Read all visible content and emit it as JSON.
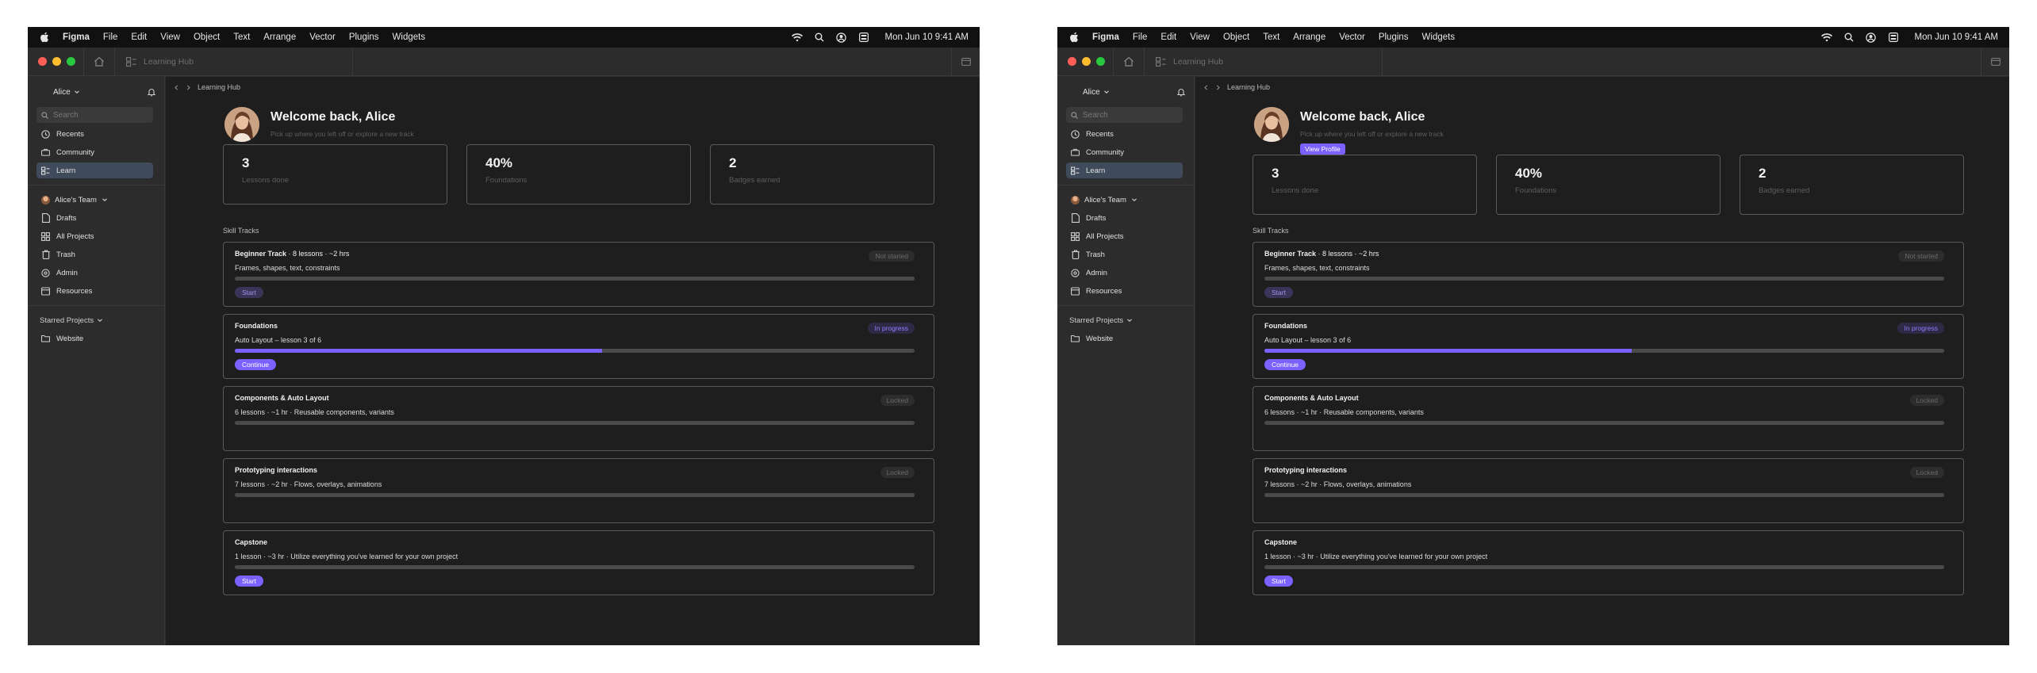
{
  "menubar": {
    "app_name": "Figma",
    "menus": [
      "File",
      "Edit",
      "View",
      "Object",
      "Text",
      "Arrange",
      "Vector",
      "Plugins",
      "Widgets"
    ],
    "clock": "Mon Jun 10  9:41 AM"
  },
  "window": {
    "file_tab_title": "Learning Hub"
  },
  "sidebar": {
    "user_name": "Alice",
    "search_placeholder": "Search",
    "nav": [
      {
        "label": "Recents",
        "icon": "clock-icon"
      },
      {
        "label": "Community",
        "icon": "community-icon"
      },
      {
        "label": "Learn",
        "icon": "learn-icon",
        "active": true
      }
    ],
    "team_name": "Alice's Team",
    "team_items": [
      {
        "label": "Drafts",
        "icon": "file-icon"
      },
      {
        "label": "All Projects",
        "icon": "grid-icon"
      },
      {
        "label": "Trash",
        "icon": "trash-icon"
      },
      {
        "label": "Admin",
        "icon": "gear-icon"
      },
      {
        "label": "Resources",
        "icon": "resources-icon"
      }
    ],
    "starred_heading": "Starred Projects",
    "starred_items": [
      {
        "label": "Website",
        "icon": "folder-icon"
      }
    ]
  },
  "breadcrumb": {
    "current": "Learning Hub"
  },
  "welcome": {
    "title": "Welcome back, Alice",
    "subtitle": "Pick up where you left off or explore a new track",
    "profile_button": "View Profile"
  },
  "stats": [
    {
      "value": "3",
      "label": "Lessons done"
    },
    {
      "value": "40%",
      "label": "Foundations"
    },
    {
      "value": "2",
      "label": "Badges earned"
    }
  ],
  "tracks_heading": "Skill Tracks",
  "tracks": [
    {
      "title": "Beginner Track",
      "title_suffix": " · 8 lessons · ~2 hrs",
      "meta": "Frames, shapes, text, constraints",
      "status": "Not started",
      "status_kind": "muted",
      "progress": 0,
      "button": "Start",
      "button_kind": "dim"
    },
    {
      "title": "Foundations",
      "title_suffix": "",
      "meta": "Auto Layout – lesson 3 of 6",
      "status": "In progress",
      "status_kind": "progress",
      "progress": 0.54,
      "button": "Continue",
      "button_kind": "primary"
    },
    {
      "title": "Components & Auto Layout",
      "title_suffix": "",
      "meta": "6 lessons · ~1 hr · Reusable components, variants",
      "status": "Locked",
      "status_kind": "muted",
      "progress": 0,
      "button": "",
      "button_kind": ""
    },
    {
      "title": "Prototyping interactions",
      "title_suffix": "",
      "meta": "7 lessons · ~2 hr · Flows, overlays, animations",
      "status": "Locked",
      "status_kind": "muted",
      "progress": 0,
      "button": "",
      "button_kind": ""
    },
    {
      "title": "Capstone",
      "title_suffix": "",
      "meta": "1 lesson · ~3 hr · Utilize everything you've learned for your own project",
      "status": "",
      "status_kind": "",
      "progress": 0,
      "button": "Start",
      "button_kind": "primary"
    }
  ],
  "colors": {
    "accent": "#7b61ff",
    "background": "#1e1e1e",
    "sidebar": "#2c2c2c"
  }
}
